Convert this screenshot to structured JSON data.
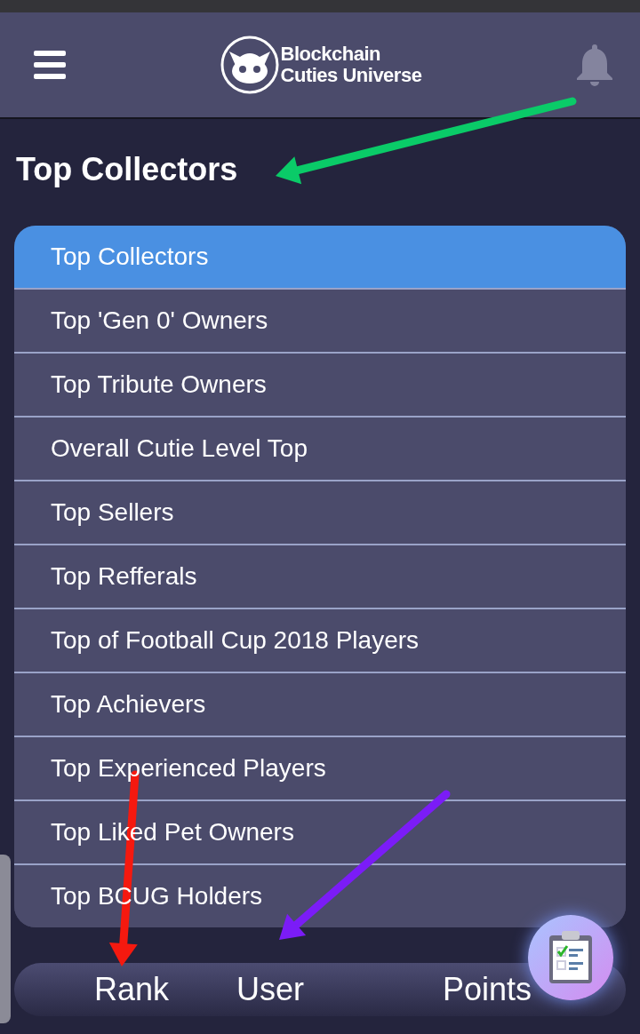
{
  "header": {
    "logo_line_1": "Blockchain",
    "logo_line_2": "Cuties Universe"
  },
  "page_title": "Top Collectors",
  "menu": [
    {
      "label": "Top Collectors",
      "selected": true
    },
    {
      "label": "Top 'Gen 0' Owners",
      "selected": false
    },
    {
      "label": "Top Tribute Owners",
      "selected": false
    },
    {
      "label": "Overall Cutie Level Top",
      "selected": false
    },
    {
      "label": "Top Sellers",
      "selected": false
    },
    {
      "label": "Top Refferals",
      "selected": false
    },
    {
      "label": "Top of Football Cup 2018 Players",
      "selected": false
    },
    {
      "label": "Top Achievers",
      "selected": false
    },
    {
      "label": "Top Experienced Players",
      "selected": false
    },
    {
      "label": "Top Liked Pet Owners",
      "selected": false
    },
    {
      "label": "Top BCUG Holders",
      "selected": false
    }
  ],
  "table": {
    "columns": [
      "Rank",
      "User",
      "Points"
    ]
  },
  "annotations": [
    {
      "color": "#0acb68"
    },
    {
      "color": "#f5190f"
    },
    {
      "color": "#7b1cf7"
    }
  ]
}
